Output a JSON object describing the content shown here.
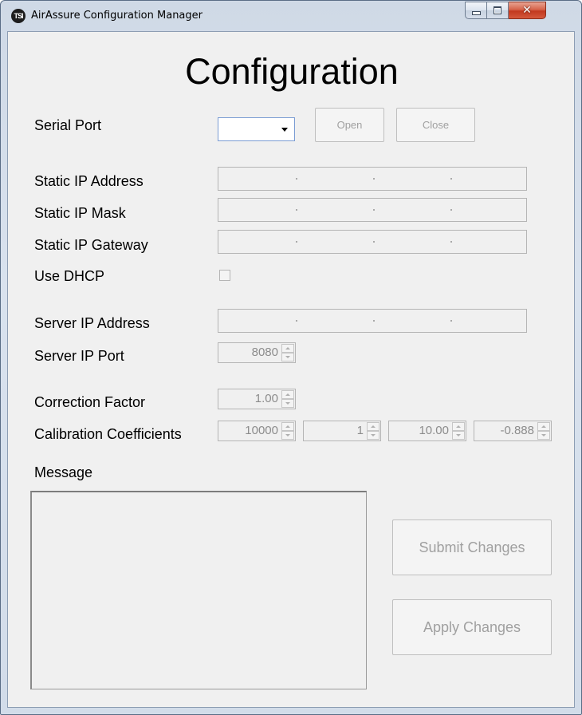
{
  "window": {
    "title": "AirAssure Configuration Manager",
    "app_icon_text": "TSI"
  },
  "caption": {
    "minimize": "minimize",
    "maximize": "maximize",
    "close": "✕"
  },
  "form": {
    "heading": "Configuration",
    "serial_port": {
      "label": "Serial Port",
      "selected": "",
      "open_label": "Open",
      "close_label": "Close"
    },
    "static_ip_address": {
      "label": "Static IP Address"
    },
    "static_ip_mask": {
      "label": "Static IP Mask"
    },
    "static_ip_gateway": {
      "label": "Static IP Gateway"
    },
    "use_dhcp": {
      "label": "Use DHCP",
      "checked": false
    },
    "server_ip_address": {
      "label": "Server IP Address"
    },
    "server_ip_port": {
      "label": "Server IP Port",
      "value": "8080"
    },
    "correction_factor": {
      "label": "Correction Factor",
      "value": "1.00"
    },
    "calibration_coefficients": {
      "label": "Calibration Coefficients",
      "values": [
        "10000",
        "1",
        "10.00",
        "-0.888"
      ]
    },
    "message": {
      "label": "Message",
      "text": ""
    },
    "submit_label": "Submit Changes",
    "apply_label": "Apply Changes"
  },
  "colors": {
    "title_gradient": "#cfd9e6",
    "client_bg": "#f0f0f0",
    "disabled_text": "#a0a0a0",
    "close_button": "#c2391f"
  },
  "icons": [
    "tsi-app-icon",
    "minimize-icon",
    "maximize-icon",
    "close-icon",
    "dropdown-arrow-icon",
    "spin-up-icon",
    "spin-down-icon"
  ]
}
